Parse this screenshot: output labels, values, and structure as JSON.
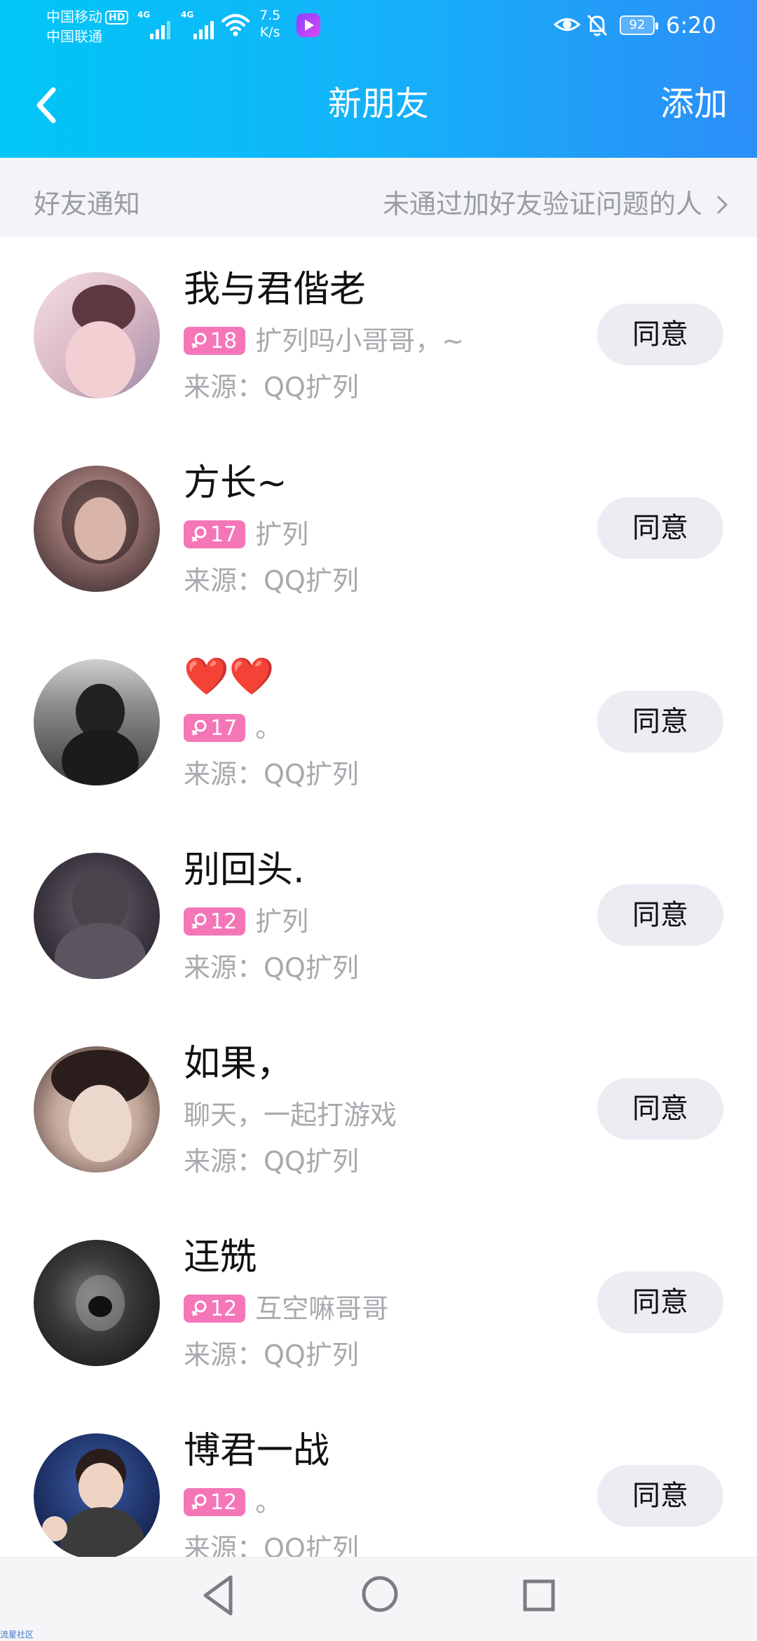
{
  "status_bar": {
    "carrier1": "中国移动",
    "hd": "HD",
    "carrier2": "中国联通",
    "sig1_label": "4G",
    "sig2_label": "4G",
    "speed_value": "7.5",
    "speed_unit": "K/s",
    "battery": "92",
    "time": "6:20"
  },
  "header": {
    "title": "新朋友",
    "add_label": "添加",
    "back_icon": "chevron-left-icon"
  },
  "section": {
    "title": "好友通知",
    "link": "未通过加好友验证问题的人"
  },
  "requests": [
    {
      "name": "我与君偕老",
      "age": "18",
      "message": "扩列吗小哥哥，~",
      "source": "来源：QQ扩列",
      "button": "同意",
      "has_badge": true
    },
    {
      "name": "方长~",
      "age": "17",
      "message": "扩列",
      "source": "来源：QQ扩列",
      "button": "同意",
      "has_badge": true
    },
    {
      "name": "❤️❤️",
      "age": "17",
      "message": "。",
      "source": "来源：QQ扩列",
      "button": "同意",
      "has_badge": true
    },
    {
      "name": "别回头.",
      "age": "12",
      "message": "扩列",
      "source": "来源：QQ扩列",
      "button": "同意",
      "has_badge": true
    },
    {
      "name": "如果，",
      "age": "",
      "message": "聊天，一起打游戏",
      "source": "来源：QQ扩列",
      "button": "同意",
      "has_badge": false
    },
    {
      "name": "迋兟",
      "age": "12",
      "message": "互空嘛哥哥",
      "source": "来源：QQ扩列",
      "button": "同意",
      "has_badge": true
    },
    {
      "name": "博君一战",
      "age": "12",
      "message": "。",
      "source": "来源：QQ扩列",
      "button": "同意",
      "has_badge": true
    }
  ],
  "colors": {
    "header_start": "#00c6f6",
    "header_end": "#2c8ef8",
    "badge": "#f476b7",
    "button_bg": "#ebedf3",
    "muted_text": "#a8a9ae"
  },
  "watermark": "流星社区"
}
